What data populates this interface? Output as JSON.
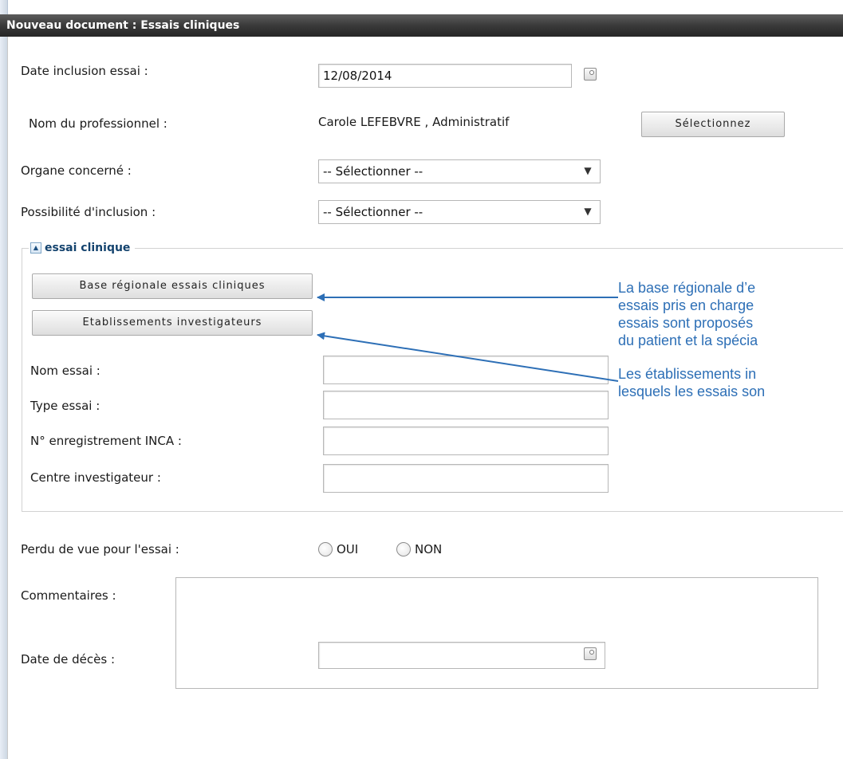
{
  "window": {
    "title": "Nouveau document : Essais cliniques"
  },
  "form": {
    "date_inclusion": {
      "label": "Date inclusion essai :",
      "value": "12/08/2014",
      "icon": "calendar-icon"
    },
    "professionnel": {
      "label": "Nom du professionnel :",
      "value": "Carole LEFEBVRE , Administratif",
      "button": "Sélectionnez"
    },
    "organe": {
      "label": "Organe concerné :",
      "selected": "-- Sélectionner --"
    },
    "possibilite": {
      "label": "Possibilité d'inclusion :",
      "selected": "-- Sélectionner --"
    },
    "essai_section": {
      "legend": "essai clinique",
      "toggle_glyph": "▲",
      "button_base": "Base régionale essais cliniques",
      "button_etab": "Etablissements investigateurs",
      "nom_essai": {
        "label": "Nom essai :",
        "value": ""
      },
      "type_essai": {
        "label": "Type essai :",
        "value": ""
      },
      "inca": {
        "label": "N° enregistrement INCA :",
        "value": ""
      },
      "centre": {
        "label": "Centre investigateur :",
        "value": ""
      }
    },
    "perdu_vue": {
      "label": "Perdu de vue pour l'essai :",
      "option_oui": "OUI",
      "option_non": "NON"
    },
    "commentaires": {
      "label": "Commentaires :",
      "value": ""
    },
    "date_deces": {
      "label": "Date de décès :",
      "value": "",
      "icon": "calendar-icon"
    }
  },
  "annotations": {
    "note1": [
      "La base régionale d’e",
      "essais pris en charge",
      "essais sont proposés",
      "du patient et la spécia"
    ],
    "note2": [
      "Les établissements in",
      "lesquels les essais son"
    ]
  },
  "colors": {
    "annotation": "#2d6fb6",
    "legend": "#14436e",
    "titlebar": "#333333"
  }
}
